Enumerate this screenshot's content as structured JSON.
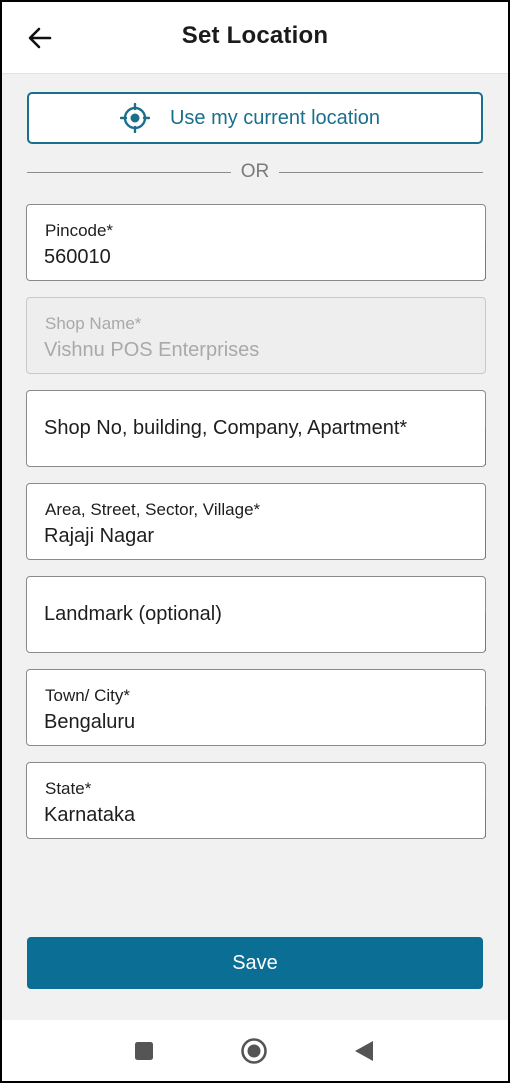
{
  "header": {
    "title": "Set Location",
    "back_icon": "arrow-left-icon"
  },
  "current_location": {
    "label": "Use my current location",
    "icon": "crosshair-icon",
    "color": "#1a6f8d"
  },
  "divider": {
    "text": "OR"
  },
  "fields": {
    "pincode": {
      "label": "Pincode*",
      "value": "560010"
    },
    "shop_name": {
      "label": "Shop Name*",
      "value": "Vishnu POS Enterprises",
      "disabled": true
    },
    "shop_no": {
      "placeholder": "Shop No, building, Company, Apartment*",
      "value": ""
    },
    "area": {
      "label": "Area, Street, Sector, Village*",
      "value": "Rajaji Nagar"
    },
    "landmark": {
      "placeholder": "Landmark (optional)",
      "value": ""
    },
    "city": {
      "label": "Town/ City*",
      "value": "Bengaluru"
    },
    "state": {
      "label": "State*",
      "value": "Karnataka"
    }
  },
  "save": {
    "label": "Save",
    "color": "#0b6e94"
  },
  "system_nav": {
    "recents_icon": "square-icon",
    "home_icon": "circle-icon",
    "back_icon": "triangle-back-icon"
  }
}
